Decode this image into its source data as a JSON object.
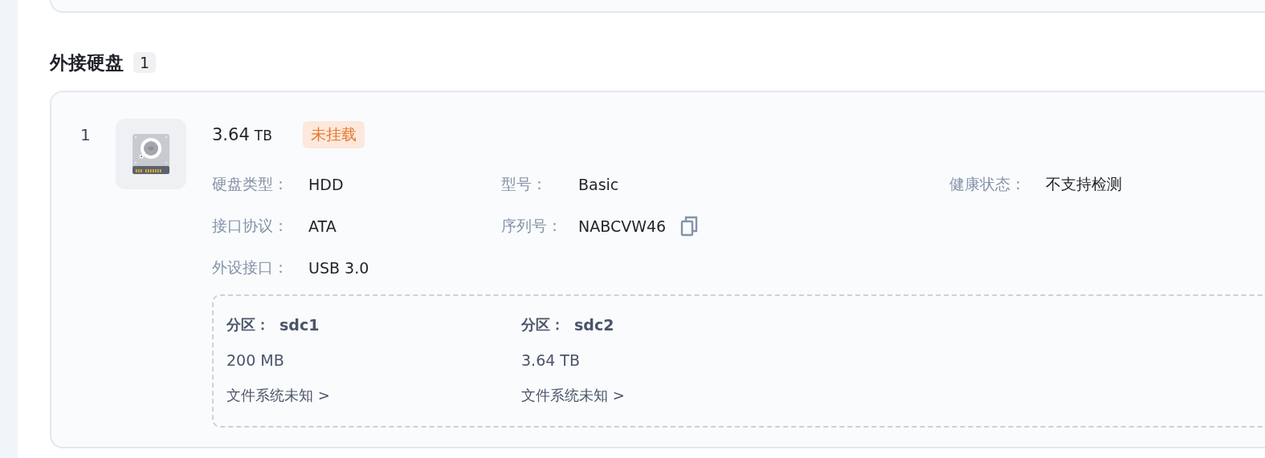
{
  "section": {
    "title": "外接硬盘",
    "count": "1"
  },
  "disks": [
    {
      "index": "1",
      "capacity": "3.64",
      "unit": "TB",
      "status": {
        "label": "未挂载",
        "mounted": false
      },
      "columns": [
        [
          {
            "label": "硬盘类型：",
            "value": "HDD"
          },
          {
            "label": "接口协议：",
            "value": "ATA"
          },
          {
            "label": "外设接口：",
            "value": "USB 3.0"
          }
        ],
        [
          {
            "label": "型号：",
            "value": "Basic"
          },
          {
            "label": "序列号：",
            "value": "NABCVW46",
            "copyable": true
          }
        ],
        [
          {
            "label": "健康状态：",
            "value": "不支持检测"
          }
        ]
      ],
      "partitions": [
        {
          "label": "分区：",
          "name": "sdc1",
          "size": "200 MB",
          "filesystem": "文件系统未知 >"
        },
        {
          "label": "分区：",
          "name": "sdc2",
          "size": "3.64 TB",
          "filesystem": "文件系统未知 >"
        }
      ]
    }
  ]
}
